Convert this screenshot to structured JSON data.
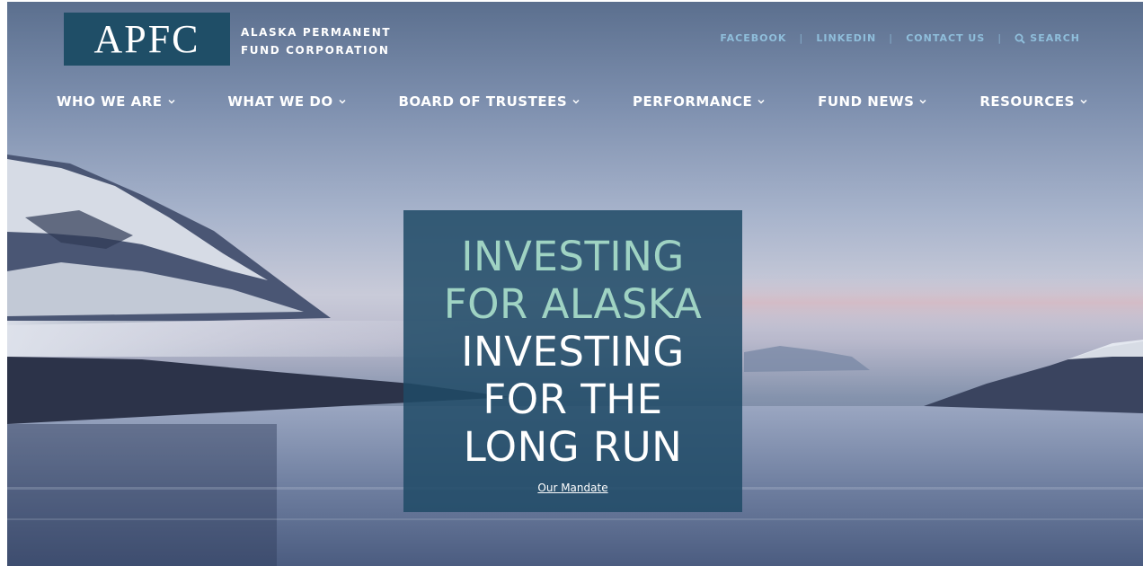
{
  "logo": {
    "mark": "APFC",
    "line1": "ALASKA PERMANENT",
    "line2": "FUND CORPORATION"
  },
  "util_nav": [
    {
      "label": "FACEBOOK"
    },
    {
      "label": "LINKEDIN"
    },
    {
      "label": "CONTACT US"
    },
    {
      "label": "SEARCH",
      "icon": "search-icon"
    }
  ],
  "main_nav": [
    {
      "label": "WHO WE ARE",
      "icon": "chevron-down-icon"
    },
    {
      "label": "WHAT WE DO",
      "icon": "chevron-down-icon"
    },
    {
      "label": "BOARD OF TRUSTEES",
      "icon": "chevron-down-icon"
    },
    {
      "label": "PERFORMANCE",
      "icon": "chevron-down-icon"
    },
    {
      "label": "FUND NEWS",
      "icon": "chevron-down-icon"
    },
    {
      "label": "RESOURCES",
      "icon": "chevron-down-icon"
    }
  ],
  "hero": {
    "teal_lines": [
      "INVESTING",
      "FOR ALASKA"
    ],
    "white_lines": [
      "INVESTING",
      "FOR THE",
      "LONG RUN"
    ],
    "link": "Our Mandate"
  },
  "colors": {
    "brand": "#1f4e67",
    "accent_teal": "#9fd3c3",
    "util_link": "#8fbedb"
  }
}
